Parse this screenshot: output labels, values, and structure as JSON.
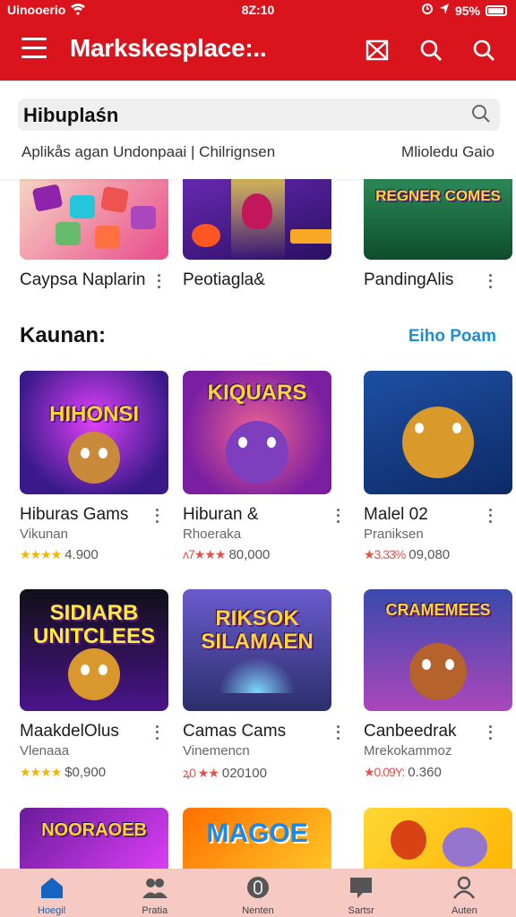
{
  "status": {
    "carrier": "Uinooerio",
    "time": "8Z:10",
    "battery": "95%"
  },
  "appbar": {
    "title": "Markskesplace:.."
  },
  "search": {
    "query": "Hibuplaśn",
    "filters": "Aplikås agan Undonpaai | Chilrignsen",
    "filters_right": "Mlioledu Gaio"
  },
  "top_row": [
    {
      "name": "Caypsa Naplarin",
      "colors": [
        "#f7d9c4",
        "#e94b8c"
      ]
    },
    {
      "name": "Peotiagla&",
      "colors": [
        "#6a2bb5",
        "#f9a825"
      ]
    },
    {
      "name": "PandingAlis",
      "colors": [
        "#2f8f5b",
        "#f4c542"
      ],
      "art_text": "REGNER COMES"
    }
  ],
  "section": {
    "title": "Kaunan:",
    "link": "Eiho Poam"
  },
  "apps": [
    {
      "name": "Hiburas Gams",
      "sub": "Vikunan",
      "stars": "★★★★",
      "star_color": "gold",
      "meta": "4.900",
      "art_text": "HIHONSI",
      "colors": [
        "#3a1a8a",
        "#e040fb"
      ],
      "creature": "#c98a3c"
    },
    {
      "name": "Hiburan &",
      "sub": "Rhoeraka",
      "stars": "ʌ7★★★",
      "star_color": "red",
      "meta": "80,000",
      "art_text": "KIQUARS",
      "colors": [
        "#c2185b",
        "#7b1fa2"
      ],
      "creature": "#7e3fbf"
    },
    {
      "name": "Malel 02",
      "sub": "Praniksen",
      "stars": "★3.33%",
      "star_color": "red",
      "meta": "09,080",
      "art_text": "",
      "colors": [
        "#1e4fa3",
        "#f7b733"
      ],
      "creature": "#d99a2b"
    },
    {
      "name": "MaakdelOlus",
      "sub": "Vlenaaa",
      "stars": "★★★★",
      "star_color": "gold",
      "meta": "$0,900",
      "art_text": "SIDIARB UNITCLEES",
      "colors": [
        "#101018",
        "#6a1b9a"
      ],
      "creature": "#d9982e"
    },
    {
      "name": "Camas Cams",
      "sub": "Vinemencn",
      "stars": "ꝝ0 ★★",
      "star_color": "red",
      "meta": "020100",
      "art_text": "RIKSOK SILAMAEN",
      "colors": [
        "#2b2f6b",
        "#6a5acd"
      ],
      "creature": "#3b3b4f"
    },
    {
      "name": "Canbeedrak",
      "sub": "Mrekokammoz",
      "stars": "★0.09Y:",
      "star_color": "red",
      "meta": "0.360",
      "art_text": "CRAMEMEES",
      "colors": [
        "#3949ab",
        "#ab47bc"
      ],
      "creature": "#b5622d"
    }
  ],
  "bottom_row": [
    {
      "art_text": "NOORAOEB",
      "colors": [
        "#6a1b9a",
        "#e040fb"
      ]
    },
    {
      "art_text": "MAGOE",
      "colors": [
        "#ff6f00",
        "#ffca28"
      ]
    },
    {
      "art_text": "",
      "colors": [
        "#fdd835",
        "#ffb300"
      ]
    }
  ],
  "bottom_nav": [
    {
      "label": "Hoegil",
      "icon": "home-icon"
    },
    {
      "label": "Pratia",
      "icon": "people-icon"
    },
    {
      "label": "Nenten",
      "icon": "badge-icon"
    },
    {
      "label": "Sartsr",
      "icon": "chat-icon"
    },
    {
      "label": "Auten",
      "icon": "person-icon"
    }
  ]
}
